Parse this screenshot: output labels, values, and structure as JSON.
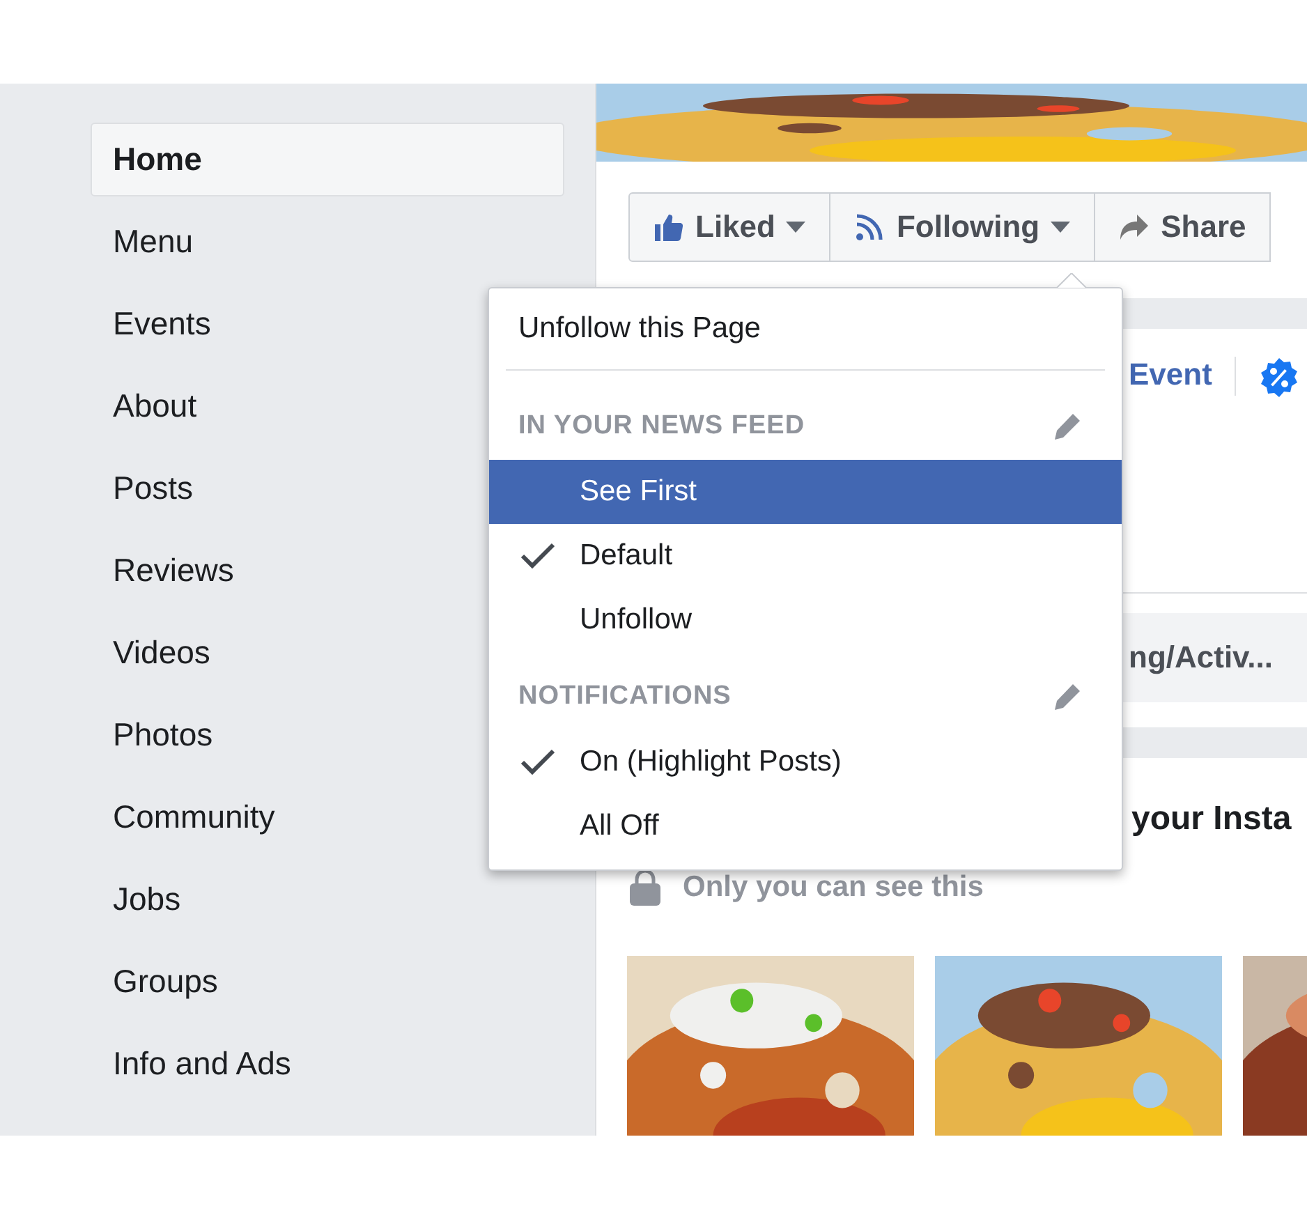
{
  "sidebar": {
    "items": [
      {
        "label": "Home",
        "selected": true
      },
      {
        "label": "Menu",
        "selected": false
      },
      {
        "label": "Events",
        "selected": false
      },
      {
        "label": "About",
        "selected": false
      },
      {
        "label": "Posts",
        "selected": false
      },
      {
        "label": "Reviews",
        "selected": false
      },
      {
        "label": "Videos",
        "selected": false
      },
      {
        "label": "Photos",
        "selected": false
      },
      {
        "label": "Community",
        "selected": false
      },
      {
        "label": "Jobs",
        "selected": false
      },
      {
        "label": "Groups",
        "selected": false
      },
      {
        "label": "Info and Ads",
        "selected": false
      }
    ]
  },
  "actions": [
    {
      "label": "Liked",
      "kind": "thumb",
      "has_menu": true
    },
    {
      "label": "Following",
      "kind": "feed",
      "has_menu": true
    },
    {
      "label": "Share",
      "kind": "share",
      "has_menu": false
    }
  ],
  "create_row": {
    "label": "Event"
  },
  "pill": {
    "label": "ng/Activ..."
  },
  "instagram": {
    "heading": "your Insta",
    "note": "Only you can see this"
  },
  "menu": {
    "top_item": "Unfollow this Page",
    "sections": [
      {
        "title": "IN YOUR NEWS FEED",
        "options": [
          {
            "label": "See First",
            "checked": false,
            "selected": true
          },
          {
            "label": "Default",
            "checked": true,
            "selected": false
          },
          {
            "label": "Unfollow",
            "checked": false,
            "selected": false
          }
        ]
      },
      {
        "title": "NOTIFICATIONS",
        "options": [
          {
            "label": "On (Highlight Posts)",
            "checked": true,
            "selected": false
          },
          {
            "label": "All Off",
            "checked": false,
            "selected": false
          }
        ]
      }
    ]
  }
}
